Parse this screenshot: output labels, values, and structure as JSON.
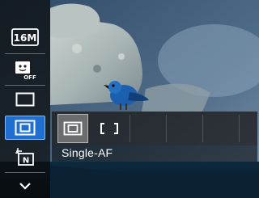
{
  "side_menu": {
    "items": [
      {
        "icon": "image-size-16m-icon",
        "label": "16M"
      },
      {
        "icon": "smile-shutter-off-icon",
        "label": "OFF"
      },
      {
        "icon": "aspect-frame-icon"
      },
      {
        "icon": "focus-area-icon",
        "selected": true
      },
      {
        "icon": "flash-auto-icon",
        "label": "N"
      },
      {
        "icon": "chevron-down-icon"
      }
    ]
  },
  "submenu": {
    "options": [
      {
        "icon": "single-af-icon",
        "selected": true
      },
      {
        "icon": "continuous-af-icon"
      }
    ],
    "selected_label": "Single-AF"
  },
  "colors": {
    "accent": "#1f6fd0",
    "menu_bg": "#0a0a0a",
    "text": "#ffffff"
  }
}
